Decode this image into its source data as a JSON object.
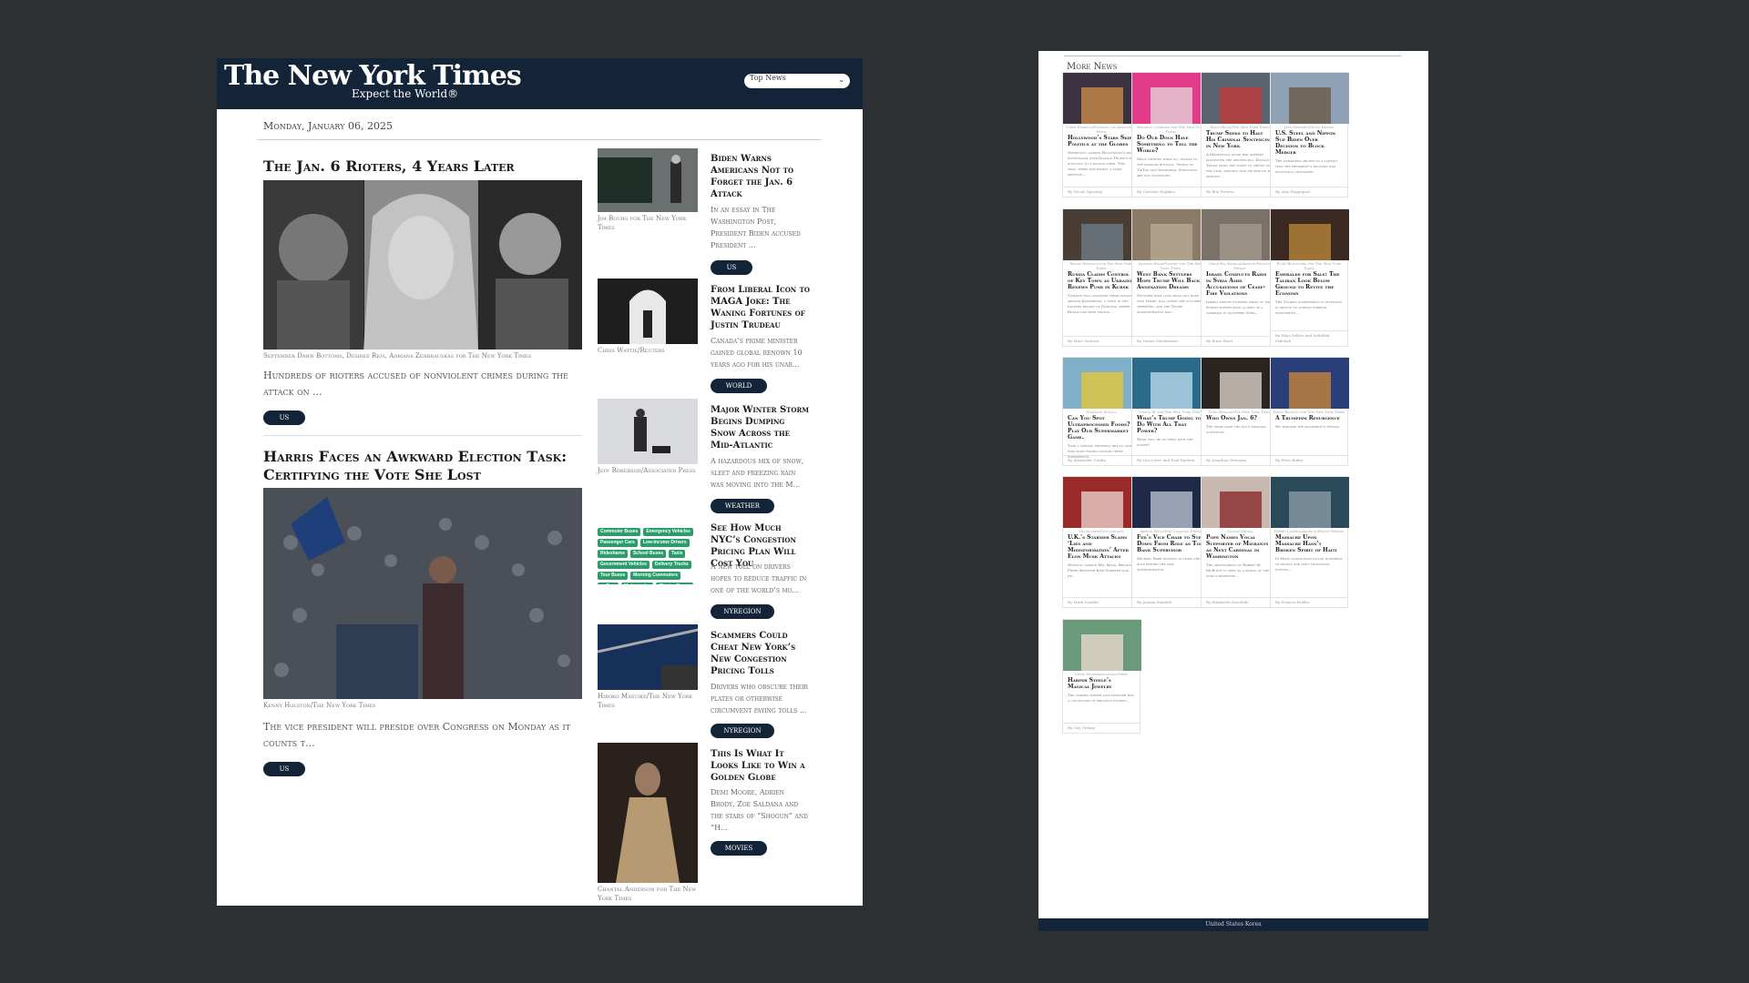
{
  "header": {
    "logo": "The New York Times",
    "tagline": "Expect the World®",
    "section_select": "Top News"
  },
  "date": "Monday, January 06, 2025",
  "lead_stories": [
    {
      "title": "The Jan. 6 Rioters, 4 Years Later",
      "credit": "September Dawn Bottoms, Desiree Rios, Adriana Zehbrauskas for The New York Times",
      "summary": "Hundreds of rioters accused of nonviolent crimes during the attack on ...",
      "tag": "US"
    },
    {
      "title": "Harris Faces an Awkward Election Task: Certifying the Vote She Lost",
      "credit": "Kenny Holston/The New York Times",
      "summary": "The vice president will preside over Congress on Monday as it counts t...",
      "tag": "US"
    }
  ],
  "side_stories": [
    {
      "title": "Biden Warns Americans Not to Forget the Jan. 6 Attack",
      "credit": "Jim Bourg for The New York Times",
      "summary": "In an essay in The Washington Post, President Biden accused President ...",
      "tag": "US"
    },
    {
      "title": "From Liberal Icon to MAGA Joke: The Waning Fortunes of Justin Trudeau",
      "credit": "Chris Wattie/Reuters",
      "summary": "Canada’s prime minister gained global renown 10 years ago for his unab...",
      "tag": "WORLD"
    },
    {
      "title": "Major Winter Storm Begins Dumping Snow Across the Mid-Atlantic",
      "credit": "Jeff Roberson/Associated Press",
      "summary": "A hazardous mix of snow, sleet and freezing rain was moving into the M...",
      "tag": "WEATHER"
    },
    {
      "title": "See How Much NYC’s Congestion Pricing Plan Will Cost You",
      "credit": "",
      "summary": "A new toll on drivers hopes to reduce traffic in one of the world’s mo...",
      "tag": "NYREGION"
    },
    {
      "title": "Scammers Could Cheat New York’s New Congestion Pricing Tolls",
      "credit": "Hiroko Masuike/The New York Times",
      "summary": "Drivers who obscure their plates or otherwise circumvent paying tolls ...",
      "tag": "NYREGION"
    },
    {
      "title": "This Is What It Looks Like to Win a Golden Globe",
      "credit": "Chantal Anderson for The New York Times",
      "summary": "Demi Moore, Adrien Brody, Zoe Saldana and the stars of “Shogun” and “H...",
      "tag": "MOVIES"
    }
  ],
  "congestion_tags": [
    [
      "Commuter Buses",
      "Emergency Vehicles"
    ],
    [
      "Passenger Cars",
      "Low-Income Drivers"
    ],
    [
      "Rideshares",
      "School Buses",
      "Taxis"
    ],
    [
      "Government Vehicles",
      "Delivery Trucks"
    ],
    [
      "Tour Buses",
      "Morning Commuters"
    ],
    [
      "ry Cars",
      "Motorcycles",
      "Charter Buses"
    ]
  ],
  "more_news": {
    "heading": "More News",
    "cards": [
      {
        "credit": "Chris Pizzello/Invision, via Associated Press",
        "title": "Hollywood’s Stars Skip Politics at the Globes",
        "summary": "Seemingly lacking Hollywood’s past enthusiasm over Donald Trump’s re-election to a second term. This year, there was barely a stray mention...",
        "byline": "By Nicole Sperling"
      },
      {
        "credit": "Mauricio Cardona for The New York Times",
        "title": "Do Our Dogs Have Something to Tell the World?",
        "summary": "Many owners think so, thanks to the popular buttons. Videos of TikTok and Instagram. Scientists are not convinced.",
        "byline": "By Caroline Hopkins"
      },
      {
        "credit": "Doug Mills/The New York Times",
        "title": "Trump Seeks to Halt His Criminal Sentencing in New York",
        "summary": "A Manhattan judge had already postponed the sentencing. Donald Trump filed the court to throw out the case, arguing that he should be immune...",
        "byline": "By Ben Protess"
      },
      {
        "credit": "Jeff Swensen/Getty Images",
        "title": "U.S. Steel and Nippon Sue Biden Over Decision to Block Merger",
        "summary": "The companies argued in a lawsuit that the president’s decision was politically motivated.",
        "byline": "By Alan Rappeport"
      },
      {
        "credit": "Maxim Dondyuk for The New York Times",
        "title": "Russia Claims Control of Key Town as Ukraine Renews Push in Kursk",
        "summary": "Ukraine has launched fresh attacks around Kurakhove, a town in the eastern region of Donetsk, where Russia has been edging...",
        "byline": "By Marc Santora"
      },
      {
        "credit": "Avishag Shaar-Yashuv for The New York Times",
        "title": "West Bank Settlers Hope Trump Will Back Annexation Dreams",
        "summary": "Settlers have long held out hope that Israel will annex the occupied territory, and the Trump administration may...",
        "byline": "By Natan Odenheimer"
      },
      {
        "credit": "Omar Haj Kadour/Agence France-Presse",
        "title": "Israel Conducts Raids in Syria Amid Accusations of Cease-Fire Violations",
        "summary": "Israeli forces entered areas of the Syrian buffer zone as part of a campaign in southern Syria...",
        "byline": "By Euan Ward"
      },
      {
        "credit": "Elise Blanchard for The New York Times",
        "title": "Emeralds for Sale: The Taliban Look Below Ground to Revive the Economy",
        "summary": "The Taliban government is investing in mining to attract foreign investment...",
        "byline": "By Elian Peltier and Safiullah Padshah"
      },
      {
        "credit": "Shannon Scholl",
        "title": "Can You Spot Ultraprocessed Foods? Play Our Supermarket Game.",
        "summary": "Take a virtual shopping trip to learn how many foods contain these ingredients.",
        "byline": "By Alexander Cardia"
      },
      {
        "credit": "Chang W. Lee/The New York Times",
        "title": "What’s Trump Going to Do With All That Power?",
        "summary": "What will he do first with the power?",
        "byline": "By Lisa Lerer and Reid Epstein"
      },
      {
        "credit": "Todd Heisler/The New York Times",
        "title": "Who Owns Jan. 6?",
        "summary": "The fight over the day’s meaning continues.",
        "byline": "By Jonathan Weisman"
      },
      {
        "credit": "Diana Bagnoli for The New York Times",
        "title": "A Trumpism Resurgence",
        "summary": "We explore the movement's return.",
        "byline": "By Peter Baker"
      },
      {
        "credit": "Oli Scarff/Getty Images",
        "title": "U.K.’s Starmer Slams ‘Lies and Misinformation’ After Elon Musk Attacks",
        "summary": "Without naming Mr. Musk, Britain’s Prime Minister Keir Starmer said he...",
        "byline": "By Mark Landler"
      },
      {
        "credit": "Adrian Wyld/The Canadian Press",
        "title": "Fed’s Vice Chair to Step Down From Role as Top Bank Supervisor",
        "summary": "Michael Barr intends to leave the role before the new administration...",
        "byline": "By Jeanna Smialek"
      },
      {
        "credit": "Vatican Media",
        "title": "Pope Names Vocal Supporter of Migrants as Next Cardinal in Washington",
        "summary": "The appointment of Robert W. McElroy is seen as a signal of the pope’s priorities...",
        "byline": "By Elisabetta Povoledo"
      },
      {
        "credit": "Pierre Lacerda/Agence France-Presse",
        "title": "Massacre Upon Massacre Hasn’t Broken Spirit of Haiti",
        "summary": "In Haiti, gangs have killed hundreds of people and sent thousands fleeing...",
        "byline": "By Frances Robles"
      },
      {
        "credit": "Chris Ware/Associated Press",
        "title": "Harper Steele’s Magical Jewelry",
        "summary": "The comedy writer and designer has a collection of precious stones...",
        "byline": "By Guy Trebay"
      }
    ]
  },
  "footer": "United States Korea",
  "colors": {
    "navy": "#142438",
    "page": "#ffffff",
    "bg": "#2d3033",
    "tag_green": "#2a9d6a"
  }
}
